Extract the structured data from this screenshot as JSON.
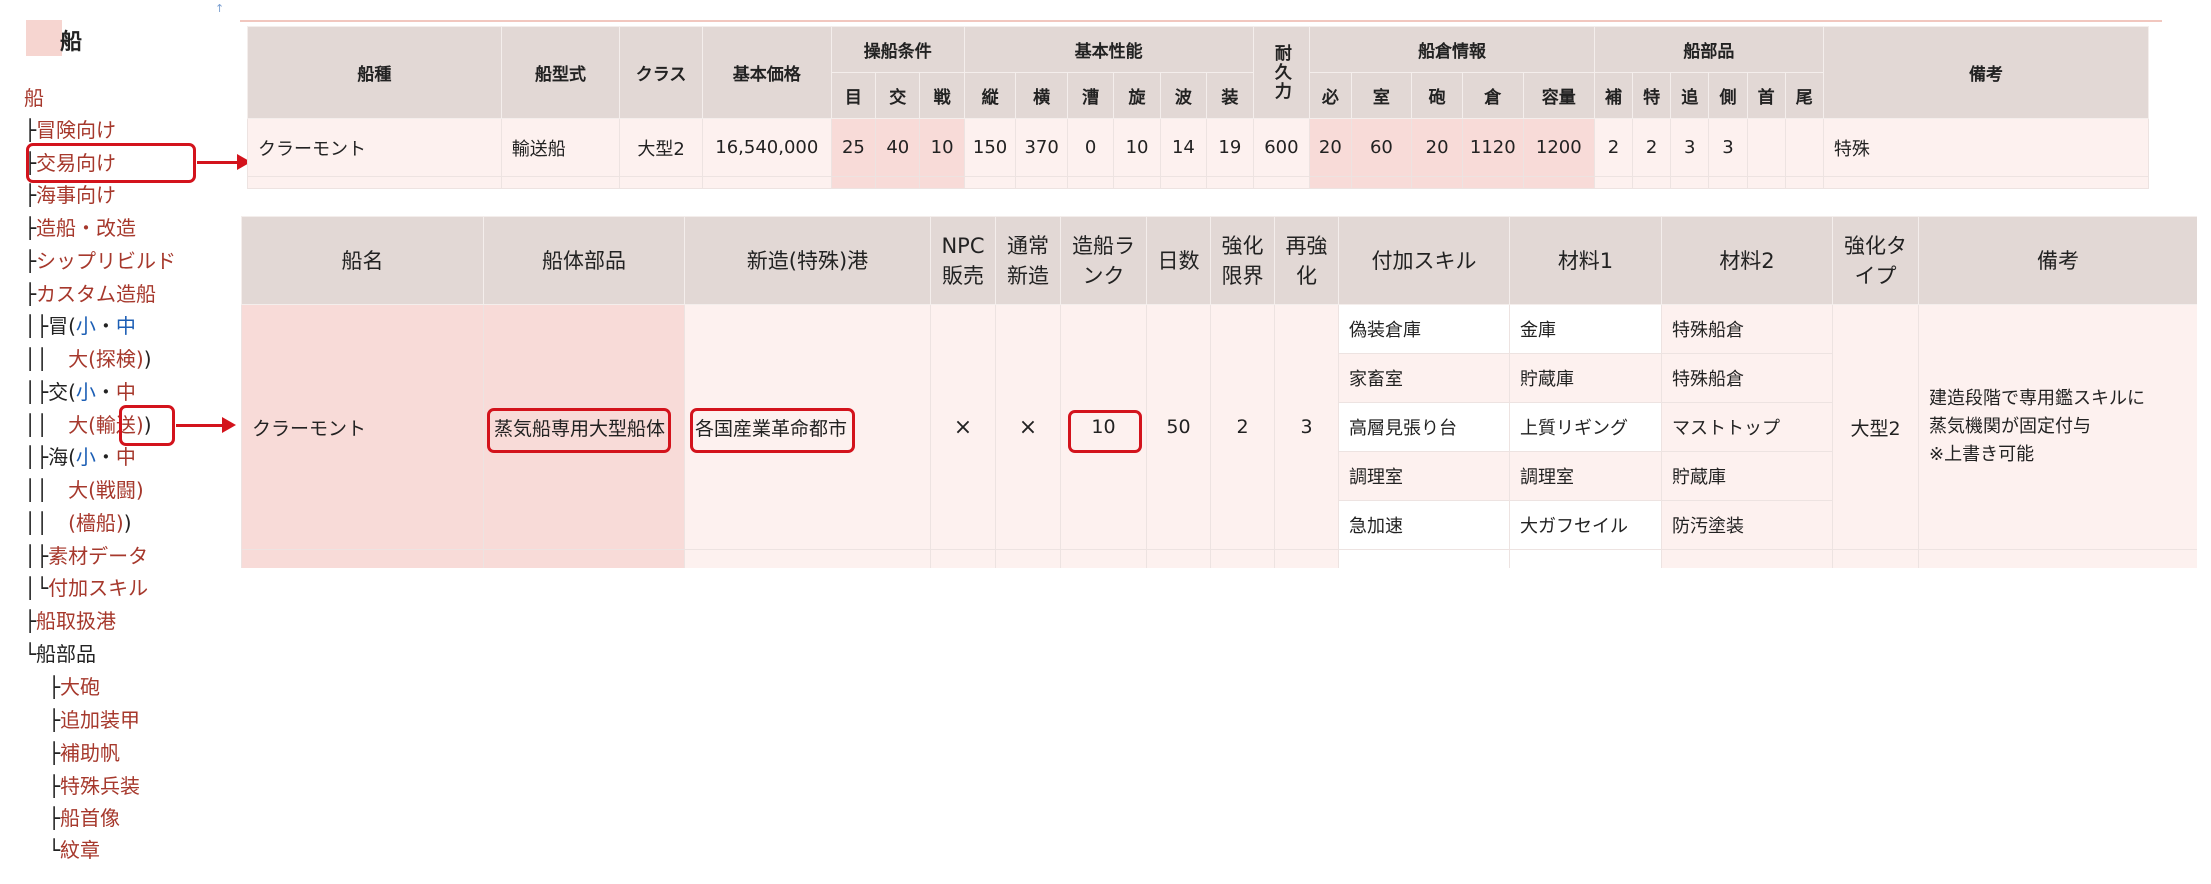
{
  "sidebar": {
    "title": "船",
    "top_mark": "↑",
    "nav": [
      {
        "prefix": "",
        "label": "船",
        "link": true
      },
      {
        "prefix": "├",
        "label": "冒険向け",
        "link": true
      },
      {
        "prefix": "├",
        "label": "交易向け",
        "link": true
      },
      {
        "prefix": "├",
        "label": "海事向け",
        "link": true
      },
      {
        "prefix": "├",
        "label": "造船・改造",
        "link": true
      },
      {
        "prefix": "├",
        "label": "シップリビルド",
        "link": true
      },
      {
        "prefix": "├",
        "label": "カスタム造船",
        "link": true
      }
    ],
    "custom": {
      "adv_prefix": "│├冒(",
      "adv_small": "小",
      "dot": "・",
      "adv_mid": "中",
      "adv2_prefix": "││　",
      "adv_large": "大",
      "adv_large_paren": "(探検)",
      "trade_prefix": "│├交(",
      "trade_small": "小",
      "trade_mid": "中",
      "trade2_prefix": "││　",
      "trade_large": "大",
      "trade_large_paren": "(輸送)",
      "nav_prefix": "│├海(",
      "nav_small": "小",
      "nav_mid": "中",
      "nav2_prefix": "││　",
      "nav_large": "大",
      "nav_large_paren": "(戦闘)",
      "nav3_prefix": "││　",
      "nav_flag": "(檣船)",
      "close": ")",
      "material_prefix": "│├",
      "material": "素材データ",
      "skill_prefix": "│└",
      "skill": "付加スキル"
    },
    "tail": [
      {
        "prefix": "├",
        "label": "船取扱港",
        "link": true
      },
      {
        "prefix": "└",
        "label": "船部品",
        "link": false
      }
    ],
    "parts": [
      {
        "prefix": "├",
        "label": "大砲"
      },
      {
        "prefix": "├",
        "label": "追加装甲"
      },
      {
        "prefix": "├",
        "label": "補助帆"
      },
      {
        "prefix": "├",
        "label": "特殊兵装"
      },
      {
        "prefix": "├",
        "label": "船首像"
      },
      {
        "prefix": "└",
        "label": "紋章"
      }
    ]
  },
  "ship_table": {
    "group_headers": {
      "type": "船種",
      "model": "船型式",
      "class": "クラス",
      "price": "基本価格",
      "conditions": "操船条件",
      "performance": "基本性能",
      "durability": "耐久力",
      "cabin": "船倉情報",
      "parts": "船部品",
      "notes": "備考"
    },
    "sub_headers": [
      "目",
      "交",
      "戦",
      "縦",
      "横",
      "漕",
      "旋",
      "波",
      "装",
      "必",
      "室",
      "砲",
      "倉",
      "容量",
      "補",
      "特",
      "追",
      "側",
      "首",
      "尾"
    ],
    "row": {
      "type": "クラーモント",
      "model": "輸送船",
      "class": "大型2",
      "price": "16,540,000",
      "cond_adv": "25",
      "cond_trade": "40",
      "cond_battle": "10",
      "vert": "150",
      "horiz": "370",
      "row_power": "0",
      "turn": "10",
      "wave": "14",
      "armor": "19",
      "durability": "600",
      "crew_min": "20",
      "crew_room": "60",
      "cannon": "20",
      "hold": "1120",
      "capacity": "1200",
      "part_aux": "2",
      "part_special": "2",
      "part_add": "3",
      "part_side": "3",
      "part_bow": "",
      "part_stern": "",
      "notes": "特殊"
    }
  },
  "build_table": {
    "headers": {
      "name": "船名",
      "hull": "船体部品",
      "port": "新造(特殊)港",
      "npc": "NPC販売",
      "normal": "通常新造",
      "rank": "造船ランク",
      "days": "日数",
      "limit": "強化限界",
      "reinforce": "再強化",
      "skill": "付加スキル",
      "mat1": "材料1",
      "mat2": "材料2",
      "type": "強化タイプ",
      "notes": "備考"
    },
    "row": {
      "name": "クラーモント",
      "hull": "蒸気船専用大型船体",
      "port": "各国産業革命都市",
      "npc": "×",
      "normal": "×",
      "rank": "10",
      "days": "50",
      "limit": "2",
      "reinforce": "3",
      "type": "大型2",
      "notes_lines": [
        "建造段階で専用鑑スキルに",
        "蒸気機関が固定付与",
        "※上書き可能"
      ]
    },
    "skills": [
      {
        "skill": "偽装倉庫",
        "mat1": "金庫",
        "mat2": "特殊船倉"
      },
      {
        "skill": "家畜室",
        "mat1": "貯蔵庫",
        "mat2": "特殊船倉"
      },
      {
        "skill": "高層見張り台",
        "mat1": "上質リギング",
        "mat2": "マストトップ"
      },
      {
        "skill": "調理室",
        "mat1": "調理室",
        "mat2": "貯蔵庫"
      },
      {
        "skill": "急加速",
        "mat1": "大ガフセイル",
        "mat2": "防汚塗装"
      }
    ]
  },
  "colors": {
    "link": "#a6382c",
    "highlight_red": "#d3131c",
    "header_bg": "#e2d8d5",
    "row_bg": "#fdf1ef",
    "pink_cell": "#f8dbd8",
    "blue_link": "#1d5fb5"
  }
}
